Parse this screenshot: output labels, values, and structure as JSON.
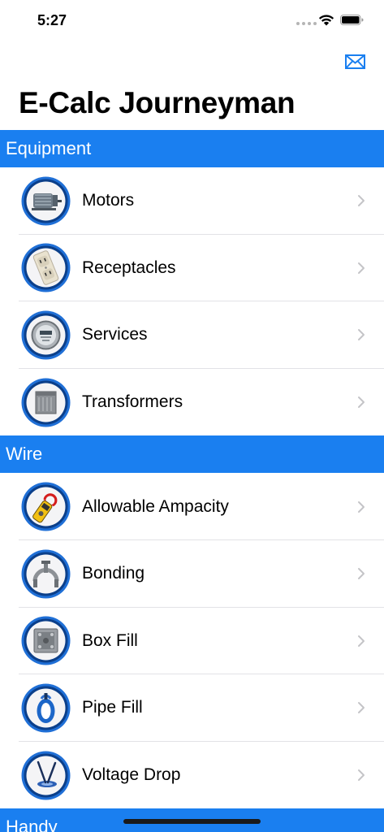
{
  "status_bar": {
    "time": "5:27",
    "icons": [
      "cellular-dots-icon",
      "wifi-icon",
      "battery-icon"
    ]
  },
  "nav": {
    "mail_icon": "envelope-icon",
    "title": "E-Calc Journeyman"
  },
  "colors": {
    "accent": "#1a7ff0",
    "separator": "#e2e2e6",
    "chevron": "#c4c4c7"
  },
  "sections": [
    {
      "header": "Equipment",
      "items": [
        {
          "label": "Motors",
          "icon": "motor-icon"
        },
        {
          "label": "Receptacles",
          "icon": "receptacle-icon"
        },
        {
          "label": "Services",
          "icon": "meter-icon"
        },
        {
          "label": "Transformers",
          "icon": "transformer-icon"
        }
      ]
    },
    {
      "header": "Wire",
      "items": [
        {
          "label": "Allowable Ampacity",
          "icon": "clamp-meter-icon"
        },
        {
          "label": "Bonding",
          "icon": "ground-clamp-icon"
        },
        {
          "label": "Box Fill",
          "icon": "junction-box-icon"
        },
        {
          "label": "Pipe Fill",
          "icon": "conduit-icon"
        },
        {
          "label": "Voltage Drop",
          "icon": "voltage-drop-icon"
        }
      ]
    },
    {
      "header": "Handy",
      "items": []
    }
  ]
}
